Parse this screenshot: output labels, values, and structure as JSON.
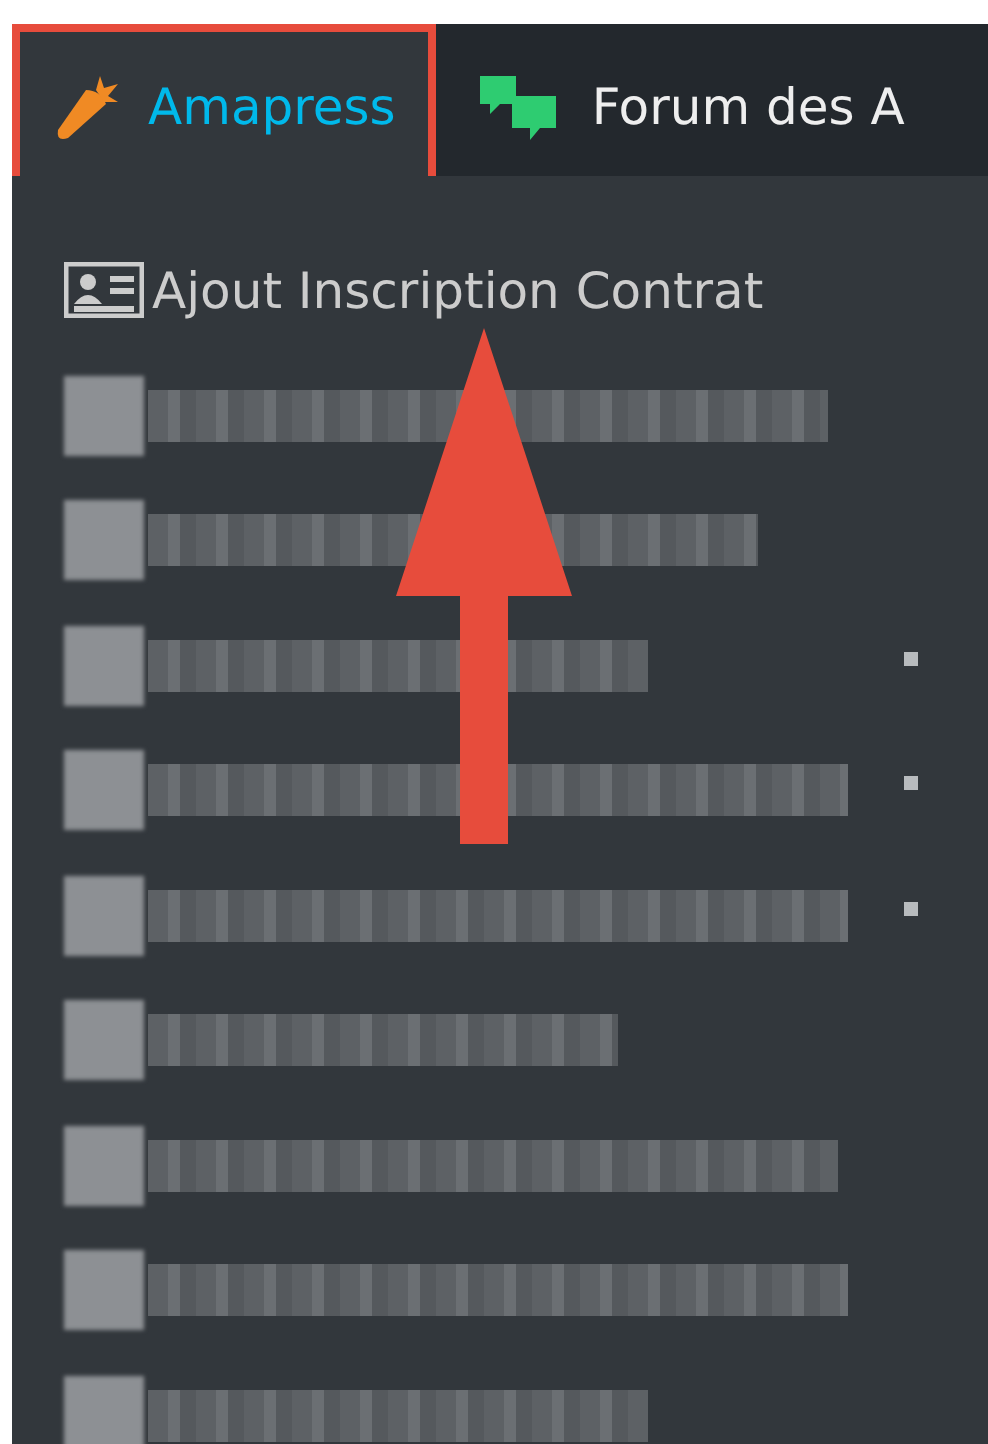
{
  "admin_bar": {
    "items": [
      {
        "label": "Amapress",
        "selected": true,
        "highlighted": true
      },
      {
        "label": "Forum des A",
        "selected": false,
        "highlighted": false
      }
    ]
  },
  "dropdown": {
    "items": [
      {
        "kind": "text",
        "label": "Ajout Inscription Contrat",
        "has_submenu": false
      },
      {
        "kind": "redacted",
        "has_submenu": false
      },
      {
        "kind": "redacted",
        "has_submenu": false
      },
      {
        "kind": "redacted",
        "has_submenu": true
      },
      {
        "kind": "redacted",
        "has_submenu": true
      },
      {
        "kind": "redacted",
        "has_submenu": true
      },
      {
        "kind": "redacted",
        "has_submenu": false
      },
      {
        "kind": "redacted",
        "has_submenu": false
      },
      {
        "kind": "redacted",
        "has_submenu": false
      },
      {
        "kind": "redacted",
        "has_submenu": false
      }
    ]
  },
  "annotation_arrow": {
    "kind": "arrow",
    "color": "#e74c3c"
  }
}
